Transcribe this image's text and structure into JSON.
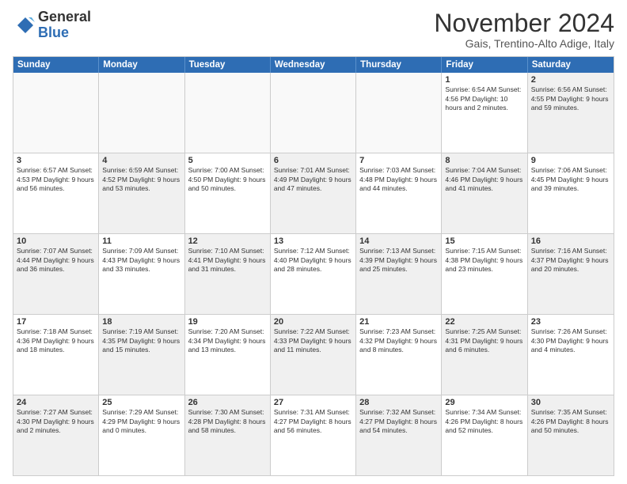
{
  "logo": {
    "general": "General",
    "blue": "Blue"
  },
  "title": "November 2024",
  "subtitle": "Gais, Trentino-Alto Adige, Italy",
  "header_days": [
    "Sunday",
    "Monday",
    "Tuesday",
    "Wednesday",
    "Thursday",
    "Friday",
    "Saturday"
  ],
  "rows": [
    [
      {
        "day": "",
        "info": "",
        "empty": true
      },
      {
        "day": "",
        "info": "",
        "empty": true
      },
      {
        "day": "",
        "info": "",
        "empty": true
      },
      {
        "day": "",
        "info": "",
        "empty": true
      },
      {
        "day": "",
        "info": "",
        "empty": true
      },
      {
        "day": "1",
        "info": "Sunrise: 6:54 AM\nSunset: 4:56 PM\nDaylight: 10 hours\nand 2 minutes."
      },
      {
        "day": "2",
        "info": "Sunrise: 6:56 AM\nSunset: 4:55 PM\nDaylight: 9 hours\nand 59 minutes.",
        "shaded": true
      }
    ],
    [
      {
        "day": "3",
        "info": "Sunrise: 6:57 AM\nSunset: 4:53 PM\nDaylight: 9 hours\nand 56 minutes."
      },
      {
        "day": "4",
        "info": "Sunrise: 6:59 AM\nSunset: 4:52 PM\nDaylight: 9 hours\nand 53 minutes.",
        "shaded": true
      },
      {
        "day": "5",
        "info": "Sunrise: 7:00 AM\nSunset: 4:50 PM\nDaylight: 9 hours\nand 50 minutes."
      },
      {
        "day": "6",
        "info": "Sunrise: 7:01 AM\nSunset: 4:49 PM\nDaylight: 9 hours\nand 47 minutes.",
        "shaded": true
      },
      {
        "day": "7",
        "info": "Sunrise: 7:03 AM\nSunset: 4:48 PM\nDaylight: 9 hours\nand 44 minutes."
      },
      {
        "day": "8",
        "info": "Sunrise: 7:04 AM\nSunset: 4:46 PM\nDaylight: 9 hours\nand 41 minutes.",
        "shaded": true
      },
      {
        "day": "9",
        "info": "Sunrise: 7:06 AM\nSunset: 4:45 PM\nDaylight: 9 hours\nand 39 minutes."
      }
    ],
    [
      {
        "day": "10",
        "info": "Sunrise: 7:07 AM\nSunset: 4:44 PM\nDaylight: 9 hours\nand 36 minutes.",
        "shaded": true
      },
      {
        "day": "11",
        "info": "Sunrise: 7:09 AM\nSunset: 4:43 PM\nDaylight: 9 hours\nand 33 minutes."
      },
      {
        "day": "12",
        "info": "Sunrise: 7:10 AM\nSunset: 4:41 PM\nDaylight: 9 hours\nand 31 minutes.",
        "shaded": true
      },
      {
        "day": "13",
        "info": "Sunrise: 7:12 AM\nSunset: 4:40 PM\nDaylight: 9 hours\nand 28 minutes."
      },
      {
        "day": "14",
        "info": "Sunrise: 7:13 AM\nSunset: 4:39 PM\nDaylight: 9 hours\nand 25 minutes.",
        "shaded": true
      },
      {
        "day": "15",
        "info": "Sunrise: 7:15 AM\nSunset: 4:38 PM\nDaylight: 9 hours\nand 23 minutes."
      },
      {
        "day": "16",
        "info": "Sunrise: 7:16 AM\nSunset: 4:37 PM\nDaylight: 9 hours\nand 20 minutes.",
        "shaded": true
      }
    ],
    [
      {
        "day": "17",
        "info": "Sunrise: 7:18 AM\nSunset: 4:36 PM\nDaylight: 9 hours\nand 18 minutes."
      },
      {
        "day": "18",
        "info": "Sunrise: 7:19 AM\nSunset: 4:35 PM\nDaylight: 9 hours\nand 15 minutes.",
        "shaded": true
      },
      {
        "day": "19",
        "info": "Sunrise: 7:20 AM\nSunset: 4:34 PM\nDaylight: 9 hours\nand 13 minutes."
      },
      {
        "day": "20",
        "info": "Sunrise: 7:22 AM\nSunset: 4:33 PM\nDaylight: 9 hours\nand 11 minutes.",
        "shaded": true
      },
      {
        "day": "21",
        "info": "Sunrise: 7:23 AM\nSunset: 4:32 PM\nDaylight: 9 hours\nand 8 minutes."
      },
      {
        "day": "22",
        "info": "Sunrise: 7:25 AM\nSunset: 4:31 PM\nDaylight: 9 hours\nand 6 minutes.",
        "shaded": true
      },
      {
        "day": "23",
        "info": "Sunrise: 7:26 AM\nSunset: 4:30 PM\nDaylight: 9 hours\nand 4 minutes."
      }
    ],
    [
      {
        "day": "24",
        "info": "Sunrise: 7:27 AM\nSunset: 4:30 PM\nDaylight: 9 hours\nand 2 minutes.",
        "shaded": true
      },
      {
        "day": "25",
        "info": "Sunrise: 7:29 AM\nSunset: 4:29 PM\nDaylight: 9 hours\nand 0 minutes."
      },
      {
        "day": "26",
        "info": "Sunrise: 7:30 AM\nSunset: 4:28 PM\nDaylight: 8 hours\nand 58 minutes.",
        "shaded": true
      },
      {
        "day": "27",
        "info": "Sunrise: 7:31 AM\nSunset: 4:27 PM\nDaylight: 8 hours\nand 56 minutes."
      },
      {
        "day": "28",
        "info": "Sunrise: 7:32 AM\nSunset: 4:27 PM\nDaylight: 8 hours\nand 54 minutes.",
        "shaded": true
      },
      {
        "day": "29",
        "info": "Sunrise: 7:34 AM\nSunset: 4:26 PM\nDaylight: 8 hours\nand 52 minutes."
      },
      {
        "day": "30",
        "info": "Sunrise: 7:35 AM\nSunset: 4:26 PM\nDaylight: 8 hours\nand 50 minutes.",
        "shaded": true
      }
    ]
  ]
}
